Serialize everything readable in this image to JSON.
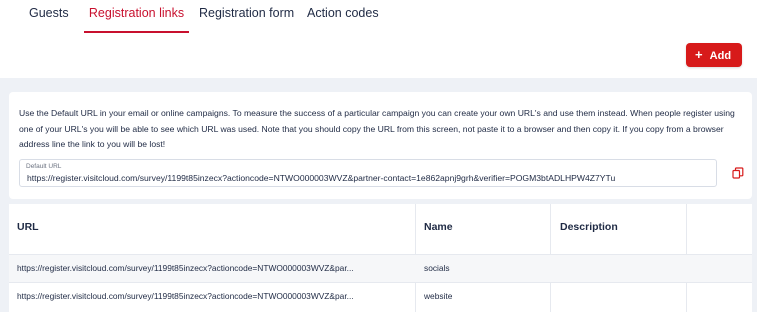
{
  "tabs": [
    {
      "label": "Guests",
      "active": false
    },
    {
      "label": "Registration links",
      "active": true
    },
    {
      "label": "Registration form",
      "active": false
    },
    {
      "label": "Action codes",
      "active": false
    }
  ],
  "add_button": {
    "label": "Add",
    "icon": "plus-icon"
  },
  "info": {
    "text": "Use the Default URL in your email or online campaigns. To measure the success of a particular campaign you can create your own URL's and use them instead. When people register using one of your URL's you will be able to see which URL was used. Note that you should copy the URL from this screen, not paste it to a browser and then copy it. If you copy from a browser address line the link to you will be lost!",
    "default_url_label": "Default URL",
    "default_url_value": "https://register.visitcloud.com/survey/1199t85inzecx?actioncode=NTWO000003WVZ&partner-contact=1e862apnj9grh&verifier=POGM3btADLHPW4Z7YTu",
    "copy_icon": "copy-icon"
  },
  "table": {
    "headers": {
      "url": "URL",
      "name": "Name",
      "description": "Description"
    },
    "rows": [
      {
        "url": "https://register.visitcloud.com/survey/1199t85inzecx?actioncode=NTWO000003WVZ&par...",
        "name": "socials",
        "description": ""
      },
      {
        "url": "https://register.visitcloud.com/survey/1199t85inzecx?actioncode=NTWO000003WVZ&par...",
        "name": "website",
        "description": ""
      }
    ]
  },
  "colors": {
    "accent": "#c8102e",
    "button": "#d71a1a",
    "background": "#eef1f6"
  }
}
